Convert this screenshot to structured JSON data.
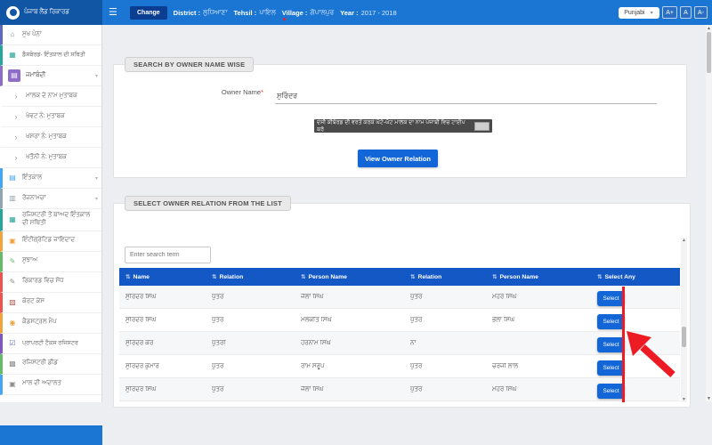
{
  "colors": {
    "header_blue": "#1a76d2",
    "logo_blue": "#1156a4",
    "table_header_blue": "#1358c5",
    "button_blue": "#1266d8",
    "active_purple": "#8e6cc8",
    "annotation_red": "#ed1c24"
  },
  "header": {
    "brand": "ਪੰਜਾਬ ਲੈਂਡ ਰਿਕਾਰਡ",
    "hamburger": "☰",
    "change_button": "Change",
    "info": [
      {
        "label": "District :",
        "value": "ਲੁਧਿਆਣਾ"
      },
      {
        "label": "Tehsil :",
        "value": "ਪਾਇਲ"
      },
      {
        "label": "Village :",
        "value": "ਗੋਪਾਲਪੁਰ"
      },
      {
        "label": "Year :",
        "value": "2017 - 2018"
      }
    ],
    "language_select": "Punjabi",
    "font_buttons": [
      "A+",
      "A",
      "A-"
    ]
  },
  "sidebar": {
    "items": [
      {
        "label": "ਮੁੱਖ ਪੰਨਾ",
        "icon": "home-icon",
        "glyph": "⌂",
        "icon_color": "#7a8aa0",
        "strip": "#5c6bc0"
      },
      {
        "label": "ਡੈਸ਼ਬੋਰਡ- ਇੰਤਕਾਲ ਦੀ ਸਥਿਤੀ",
        "icon": "dashboard-icon",
        "glyph": "▦",
        "icon_color": "#26a69a",
        "strip": "#26a69a",
        "small": true
      },
      {
        "label": "ਜਮਾਂਬੰਦੀ",
        "icon": "jamabandi-doc-icon",
        "glyph": "▤",
        "icon_color": "#ffffff",
        "strip": "#8e6cc8",
        "active": true,
        "chevron": "▾"
      },
      {
        "label": "ਮਾਲਕ ਦੇ ਨਾਮ ਮੁਤਾਬਕ",
        "icon": "chevron-right-icon",
        "glyph": "›",
        "submenu": true
      },
      {
        "label": "ਖੇਵਟ ਨੰ: ਮੁਤਾਬਕ",
        "icon": "chevron-right-icon",
        "glyph": "›",
        "submenu": true
      },
      {
        "label": "ਖਸਰਾ ਨੰ: ਮੁਤਾਬਕ",
        "icon": "chevron-right-icon",
        "glyph": "›",
        "submenu": true
      },
      {
        "label": "ਖਤੌਨੀ ਨੰ: ਮੁਤਾਬਕ",
        "icon": "chevron-right-icon",
        "glyph": "›",
        "submenu": true
      },
      {
        "label": "ਇੰਤਕਾਲ",
        "icon": "mutation-file-icon",
        "glyph": "▤",
        "icon_color": "#42a5f5",
        "strip": "#42a5f5",
        "chevron": "▾"
      },
      {
        "label": "ਰੋਜ਼ਨਾਮਚਾ",
        "icon": "roznamcha-list-icon",
        "glyph": "▥",
        "icon_color": "#90a4ae",
        "strip": "#90a4ae",
        "chevron": "▾"
      },
      {
        "label": "ਰਜਿਸਟਰੀ ਤੋਂ ਬਾਅਦ ਇੰਤਕਾਲ ਦੀ ਸਥਿਤੀ",
        "icon": "registry-status-icon",
        "glyph": "▦",
        "icon_color": "#26a69a",
        "strip": "#26a69a",
        "two_line": true
      },
      {
        "label": "ਇੰਟੀਗ੍ਰੇਟਿਡ ਜਾਇਦਾਦ",
        "icon": "integrated-property-icon",
        "glyph": "▣",
        "icon_color": "#f2a33c",
        "strip": "#f2a33c"
      },
      {
        "label": "ਸੁਝਾਅ",
        "icon": "suggestion-icon",
        "glyph": "✎",
        "icon_color": "#66bb6a",
        "strip": "#66bb6a"
      },
      {
        "label": "ਰਿਕਾਰਡ ਵਿਚ ਸੋਧ",
        "icon": "record-correction-icon",
        "glyph": "✎",
        "icon_color": "#8d8d8d",
        "strip": "#ef5350"
      },
      {
        "label": "ਕੋਰਟ ਕੇਸ",
        "icon": "court-case-icon",
        "glyph": "▨",
        "icon_color": "#a8574a",
        "strip": "#ef5350"
      },
      {
        "label": "ਕੈਡਸਟ੍ਰਲ ਮੈਪ",
        "icon": "cadastral-map-icon",
        "glyph": "◉",
        "icon_color": "#f2a33c",
        "strip": "#f2a33c"
      },
      {
        "label": "ਪ੍ਰਾਪਰਟੀ ਟੈਕਸ ਰਜਿਸਟਰ",
        "icon": "property-tax-register-icon",
        "glyph": "☑",
        "icon_color": "#5c6bc0",
        "strip": "#7e57c2",
        "small": true
      },
      {
        "label": "ਰਜਿਸਟਰੀ ਡੀਡ",
        "icon": "registry-deed-icon",
        "glyph": "▩",
        "icon_color": "#8d8d8d",
        "strip": "#66bb6a"
      },
      {
        "label": "ਮਾਲ ਦੀ ਅਦਾਲਤ",
        "icon": "mal-adalat-icon",
        "glyph": "▣",
        "icon_color": "#8d8d8d",
        "strip": "#42a5f5"
      }
    ]
  },
  "search_section": {
    "title": "SEARCH BY OWNER NAME WISE",
    "owner_name_label": "Owner Name",
    "required_mark": "*",
    "owner_name_value": "ਸੁਰਿੰਦਰ",
    "tooltip": "ਦੇਸੀ ਕੀਬੋਰਡ ਦੀ ਵਰਤੋਂ ਕਰਕੇ ਘੱਟੋ-ਘੱਟ ਮਾਲਕ ਦਾ ਨਾਮ ਪੰਜਾਬੀ ਵਿਚ ਟਾਈਪ ਕਰੋ",
    "button": "View Owner Relation"
  },
  "relation_section": {
    "title": "SELECT OWNER RELATION FROM THE LIST",
    "search_placeholder": "Enter search term",
    "sort_icon": "⇅",
    "table": {
      "columns": [
        "Name",
        "Relation",
        "Person Name",
        "Relation",
        "Person Name",
        "Select Any"
      ],
      "rows": [
        [
          "ਸੁਰਿੰਦਰ ਸਿੰਘ",
          "ਪੁੱਤਰ",
          "ਜੈਲਾ ਸਿੰਘ",
          "ਪੁੱਤਰ",
          "ਮੇਹਰ ਸਿੰਘ",
          "Select"
        ],
        [
          "ਸੁਰਿੰਦਰ ਸਿੰਘ",
          "ਪੁੱਤਰ",
          "ਮਲਕੀਤ ਸਿੰਘ",
          "ਪੁੱਤਰ",
          "ਭੋਲਾ ਸਿੰਘ",
          "Select"
        ],
        [
          "ਸੁਰਿੰਦਰ ਕੌਰ",
          "ਪੁੱਤਰੀ",
          "ਹਰਨਾਮ ਸਿੰਘ",
          "ਨਾ",
          "",
          "Select"
        ],
        [
          "ਸੁਰਿੰਦਰ ਕੁਮਾਰ",
          "ਪੁੱਤਰ",
          "ਰਾਮ ਸਰੂਪ",
          "ਪੁੱਤਰ",
          "ਚਰੰਜੀ ਲਾਲ",
          "Select"
        ],
        [
          "ਸੁਰਿੰਦਰ ਸਿੰਘ",
          "ਪੁੱਤਰ",
          "ਜੈਲਾ ਸਿੰਘ",
          "ਪੁੱਤਰ",
          "ਮੇਹਰ ਸਿੰਘ",
          "Select"
        ]
      ]
    }
  }
}
